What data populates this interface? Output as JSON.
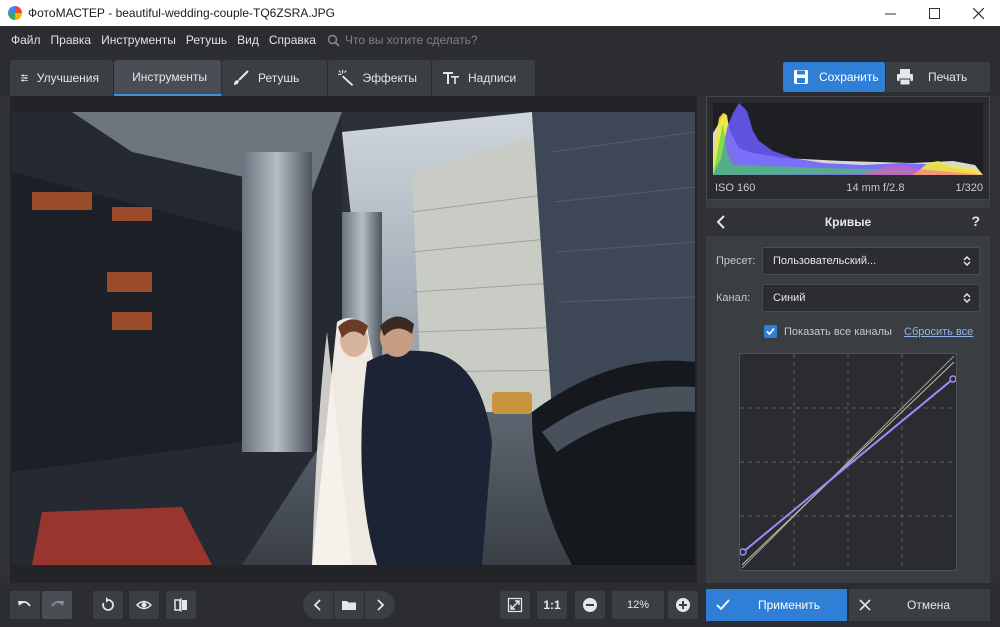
{
  "window": {
    "title": "ФотоМАСТЕР - beautiful-wedding-couple-TQ6ZSRA.JPG",
    "controls": [
      "minimize-icon",
      "maximize-icon",
      "close-icon"
    ]
  },
  "menu": {
    "items": [
      "Файл",
      "Правка",
      "Инструменты",
      "Ретушь",
      "Вид",
      "Справка"
    ],
    "search_placeholder": "Что вы хотите сделать?"
  },
  "tabs": [
    {
      "label": "Улучшения",
      "icon": "sliders-icon",
      "active": false
    },
    {
      "label": "Инструменты",
      "icon": "crop-icon",
      "active": true
    },
    {
      "label": "Ретушь",
      "icon": "brush-icon",
      "active": false
    },
    {
      "label": "Эффекты",
      "icon": "magic-wand-icon",
      "active": false
    },
    {
      "label": "Надписи",
      "icon": "text-icon",
      "active": false
    }
  ],
  "actions": {
    "save_label": "Сохранить",
    "print_label": "Печать"
  },
  "histogram": {
    "iso": "ISO 160",
    "lens": "14 mm f/2.8",
    "shutter": "1/320"
  },
  "curves": {
    "title": "Кривые",
    "help": "?",
    "preset_label": "Пресет:",
    "preset_value": "Пользовательский...",
    "channel_label": "Канал:",
    "channel_value": "Синий",
    "show_all_label": "Показать все каналы",
    "show_all_checked": true,
    "reset_label": "Сбросить все",
    "curve_color": "#9b8cff"
  },
  "bottom": {
    "zoom_fit": "1:1",
    "zoom_value": "12%",
    "apply_label": "Применить",
    "cancel_label": "Отмена"
  },
  "colors": {
    "accent": "#2f7fd6",
    "panel": "#3a3d41",
    "background": "#2b2d30"
  }
}
